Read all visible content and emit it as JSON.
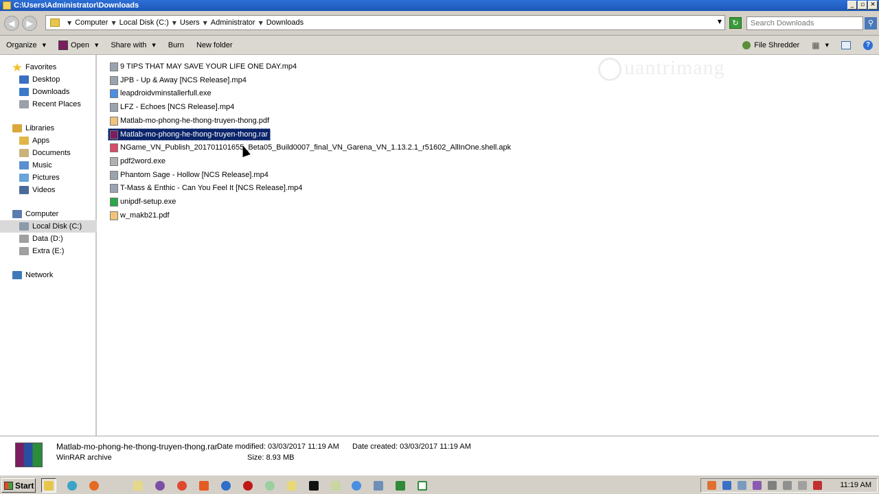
{
  "window": {
    "title": "C:\\Users\\Administrator\\Downloads",
    "min_glyph": "_",
    "max_glyph": "▫",
    "close_glyph": "✕"
  },
  "address": {
    "back_glyph": "◀",
    "forward_glyph": "▶",
    "crumbs": [
      "Computer",
      "Local Disk (C:)",
      "Users",
      "Administrator",
      "Downloads"
    ],
    "search_placeholder": "Search Downloads",
    "refresh_glyph": "↻",
    "search_glyph": "⚲"
  },
  "commandbar": {
    "organize": "Organize",
    "open": "Open",
    "share_with": "Share with",
    "burn": "Burn",
    "new_folder": "New folder",
    "file_shredder": "File Shredder"
  },
  "sidebar": {
    "favorites": "Favorites",
    "favorites_items": [
      "Desktop",
      "Downloads",
      "Recent Places"
    ],
    "libraries": "Libraries",
    "libraries_items": [
      "Apps",
      "Documents",
      "Music",
      "Pictures",
      "Videos"
    ],
    "computer": "Computer",
    "computer_items": [
      "Local Disk (C:)",
      "Data (D:)",
      "Extra (E:)"
    ],
    "network": "Network"
  },
  "files": [
    {
      "name": "9 TIPS THAT MAY SAVE YOUR LIFE ONE DAY.mp4",
      "icon": "video-icon",
      "color": "#9aa4b0"
    },
    {
      "name": "JPB - Up & Away [NCS Release].mp4",
      "icon": "video-icon",
      "color": "#9aa4b0"
    },
    {
      "name": "leapdroidvminstallerfull.exe",
      "icon": "leapdroid-icon",
      "color": "#4d8fe0"
    },
    {
      "name": "LFZ - Echoes [NCS Release].mp4",
      "icon": "video-icon",
      "color": "#9aa4b0"
    },
    {
      "name": "Matlab-mo-phong-he-thong-truyen-thong.pdf",
      "icon": "pdf-icon",
      "color": "#f1c27a"
    },
    {
      "name": "Matlab-mo-phong-he-thong-truyen-thong.rar",
      "icon": "winrar-icon",
      "color": "#7b1d5e"
    },
    {
      "name": "NGame_VN_Publish_201701101655_Beta05_Build0007_final_VN_Garena_VN_1.13.2.1_r51602_AllInOne.shell.apk",
      "icon": "apk-icon",
      "color": "#d84a6a"
    },
    {
      "name": "pdf2word.exe",
      "icon": "exe-icon",
      "color": "#b0b0b0"
    },
    {
      "name": "Phantom Sage - Hollow [NCS Release].mp4",
      "icon": "video-icon",
      "color": "#9aa4b0"
    },
    {
      "name": "T-Mass & Enthic - Can You Feel It [NCS Release].mp4",
      "icon": "video-icon",
      "color": "#9aa4b0"
    },
    {
      "name": "unipdf-setup.exe",
      "icon": "unipdf-icon",
      "color": "#2ca84a"
    },
    {
      "name": "w_makb21.pdf",
      "icon": "pdf-icon",
      "color": "#f1c27a"
    }
  ],
  "selected_index": 5,
  "watermark": "uantrimang",
  "details": {
    "name": "Matlab-mo-phong-he-thong-truyen-thong.rar",
    "type": "WinRAR archive",
    "date_modified": "Date modified: 03/03/2017 11:19 AM",
    "size": "Size: 8.93 MB",
    "date_created": "Date created: 03/03/2017 11:19 AM"
  },
  "taskbar": {
    "start": "Start",
    "clock": "11:19 AM"
  },
  "colors": {
    "selection": "#0a246a",
    "titlebar": "#1d57b8"
  }
}
